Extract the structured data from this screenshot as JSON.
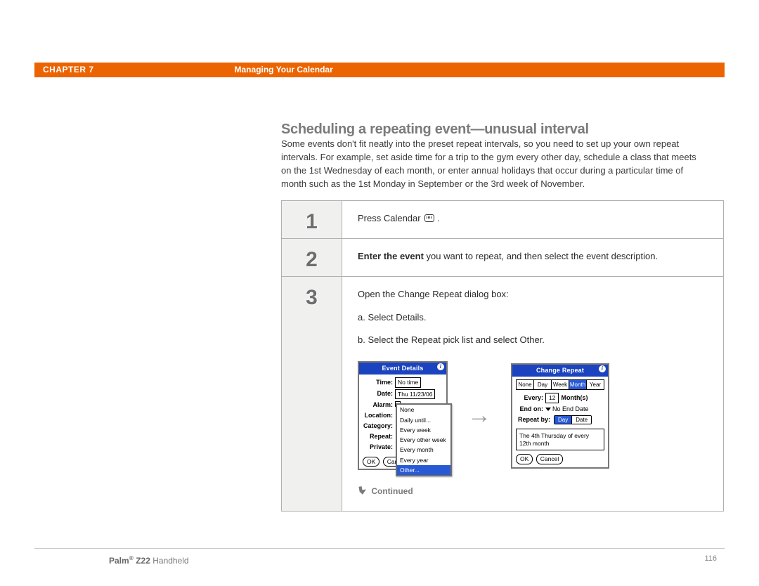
{
  "header": {
    "chapter": "CHAPTER 7",
    "title": "Managing Your Calendar"
  },
  "section": {
    "title": "Scheduling a repeating event—unusual interval",
    "intro": "Some events don't fit neatly into the preset repeat intervals, so you need to set up your own repeat intervals. For example, set aside time for a trip to the gym every other day, schedule a class that meets on the 1st Wednesday of each month, or enter annual holidays that occur during a particular time of month such as the 1st Monday in September or the 3rd week of November."
  },
  "steps": {
    "s1": {
      "num": "1",
      "text_a": "Press Calendar ",
      "text_b": "."
    },
    "s2": {
      "num": "2",
      "bold": "Enter the event",
      "rest": " you want to repeat, and then select the event description."
    },
    "s3": {
      "num": "3",
      "line1": "Open the Change Repeat dialog box:",
      "a": "a.  Select Details.",
      "b": "b.  Select the Repeat pick list and select Other."
    }
  },
  "eventDetails": {
    "title": "Event Details",
    "labels": {
      "time": "Time:",
      "date": "Date:",
      "alarm": "Alarm:",
      "location": "Location:",
      "category": "Category:",
      "repeat": "Repeat:",
      "private": "Private:"
    },
    "values": {
      "time": "No time",
      "date": "Thu 11/23/06"
    },
    "dropdown": [
      "None",
      "Daily until...",
      "Every week",
      "Every other week",
      "Every month",
      "Every year",
      "Other..."
    ],
    "ok": "OK",
    "cancel": "Can"
  },
  "changeRepeat": {
    "title": "Change Repeat",
    "tabs": [
      "None",
      "Day",
      "Week",
      "Month",
      "Year"
    ],
    "selTab": "Month",
    "everyLabel": "Every:",
    "everyVal": "12",
    "unit": "Month(s)",
    "endLabel": "End on:",
    "endVal": "No End Date",
    "repeatByLabel": "Repeat by:",
    "repeatByOpts": [
      "Day",
      "Date"
    ],
    "repeatBySel": "Day",
    "summary": "The 4th Thursday of every 12th month",
    "ok": "OK",
    "cancel": "Cancel"
  },
  "continued": "Continued",
  "footer": {
    "brand": "Palm",
    "model": "Z22",
    "suffix": "Handheld",
    "page": "116"
  }
}
